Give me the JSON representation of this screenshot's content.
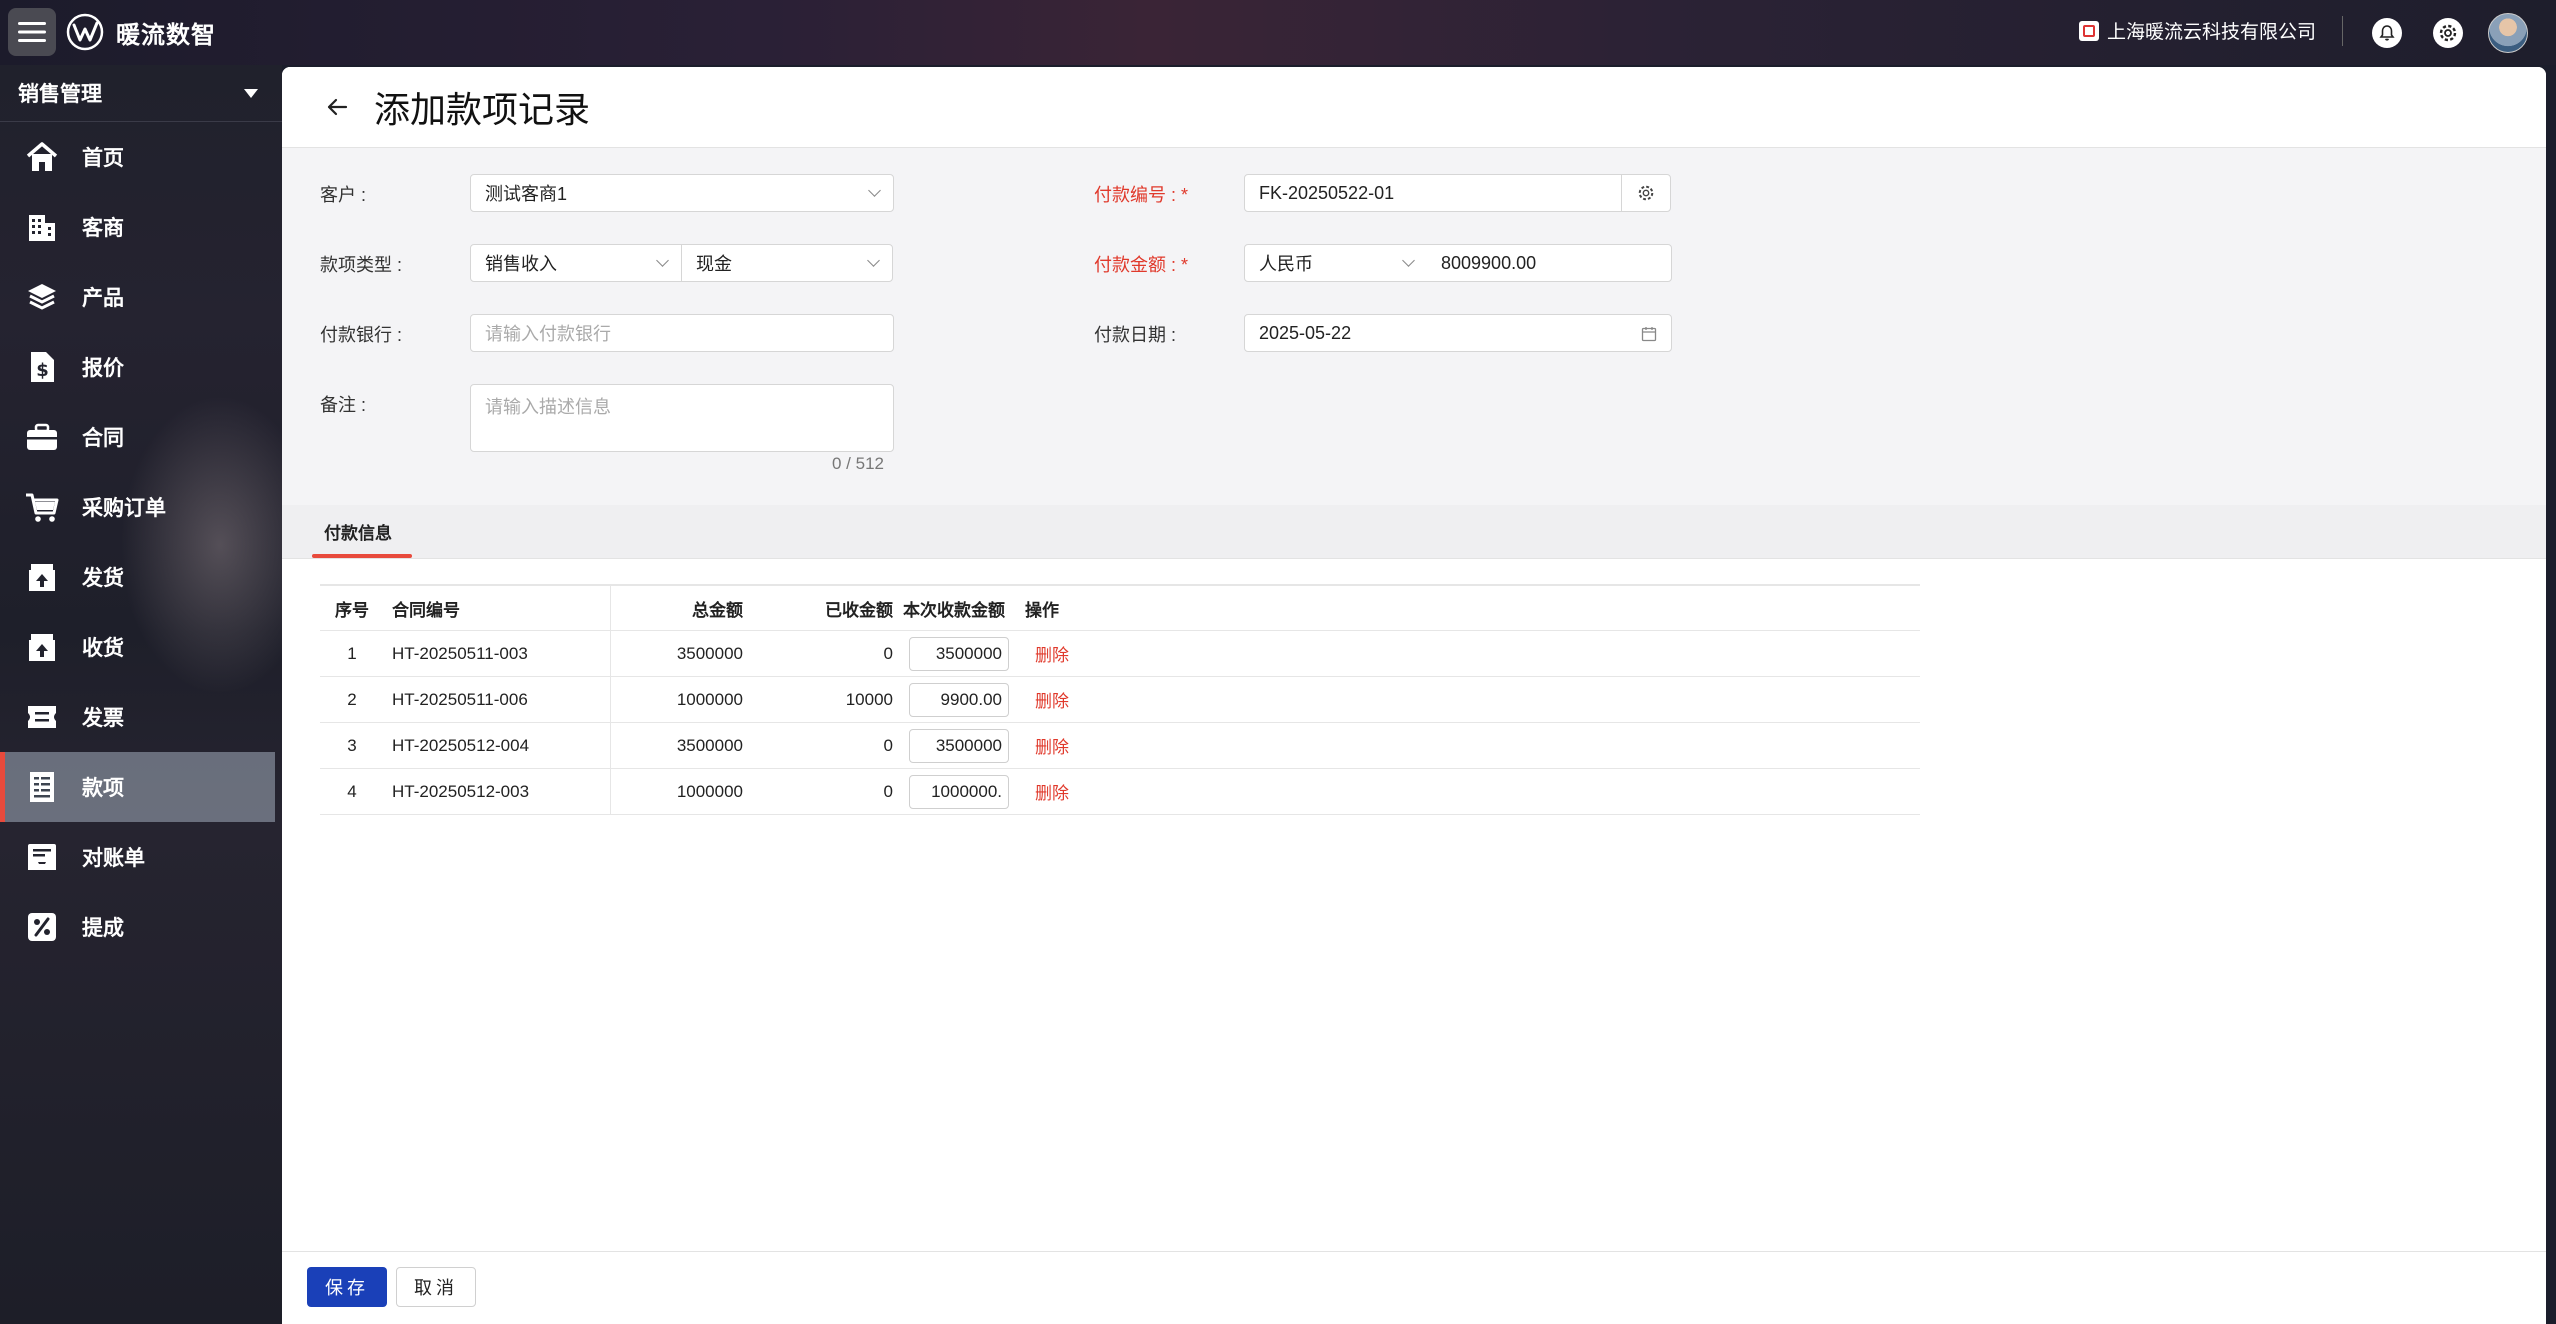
{
  "app": {
    "brand": "暖流数智",
    "company": "上海暖流云科技有限公司"
  },
  "sidebar": {
    "module": "销售管理",
    "items": [
      {
        "label": "首页",
        "icon": "home-icon"
      },
      {
        "label": "客商",
        "icon": "building-icon"
      },
      {
        "label": "产品",
        "icon": "layers-icon"
      },
      {
        "label": "报价",
        "icon": "dollar-doc-icon"
      },
      {
        "label": "合同",
        "icon": "briefcase-icon"
      },
      {
        "label": "采购订单",
        "icon": "cart-icon"
      },
      {
        "label": "发货",
        "icon": "box-up-icon"
      },
      {
        "label": "收货",
        "icon": "box-in-icon"
      },
      {
        "label": "发票",
        "icon": "ticket-icon"
      },
      {
        "label": "款项",
        "icon": "receipt-icon",
        "active": true
      },
      {
        "label": "对账单",
        "icon": "statement-icon"
      },
      {
        "label": "提成",
        "icon": "percent-icon"
      }
    ]
  },
  "page": {
    "title": "添加款项记录"
  },
  "form": {
    "customer_label": "客户 :",
    "customer_value": "测试客商1",
    "type_label": "款项类型 :",
    "type_value": "销售收入",
    "method_value": "现金",
    "bank_label": "付款银行 :",
    "bank_placeholder": "请输入付款银行",
    "remark_label": "备注 :",
    "remark_placeholder": "请输入描述信息",
    "remark_count": "0 / 512",
    "pay_no_label": "付款编号 :",
    "pay_no_value": "FK-20250522-01",
    "pay_amount_label": "付款金额 :",
    "currency_value": "人民币",
    "amount_value": "8009900.00",
    "pay_date_label": "付款日期 :",
    "pay_date_value": "2025-05-22"
  },
  "tab": {
    "label": "付款信息"
  },
  "table": {
    "headers": [
      "序号",
      "合同编号",
      "总金额",
      "已收金额",
      "本次收款金额",
      "操作"
    ],
    "rows": [
      {
        "idx": "1",
        "contract": "HT-20250511-003",
        "total": "3500000",
        "received": "0",
        "amount": "3500000",
        "op": "删除"
      },
      {
        "idx": "2",
        "contract": "HT-20250511-006",
        "total": "1000000",
        "received": "10000",
        "amount": "9900.00",
        "op": "删除"
      },
      {
        "idx": "3",
        "contract": "HT-20250512-004",
        "total": "3500000",
        "received": "0",
        "amount": "3500000",
        "op": "删除"
      },
      {
        "idx": "4",
        "contract": "HT-20250512-003",
        "total": "1000000",
        "received": "0",
        "amount": "1000000.",
        "op": "删除"
      }
    ]
  },
  "footer": {
    "save_label": "保存",
    "cancel_label": "取消"
  },
  "colors": {
    "accent_red": "#e84a3c",
    "primary_blue": "#1a40b8",
    "required_red": "#e0392b"
  }
}
